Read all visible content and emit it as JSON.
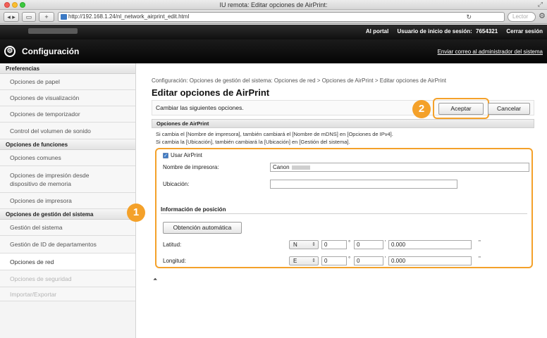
{
  "window": {
    "title": "IU remota: Editar opciones de AirPrint:",
    "url": "http://192.168.1.24/nl_network_airprint_edit.html",
    "search_placeholder": "Lector",
    "reload_icon": "reload-icon"
  },
  "topbar": {
    "portal": "Al portal",
    "user_label": "Usuario de inicio de sesión:",
    "user_id": "7654321",
    "logout": "Cerrar sesión"
  },
  "header": {
    "title": "Configuración",
    "mail_link": "Enviar correo al administrador del sistema"
  },
  "sidebar": {
    "sections": [
      {
        "heading": "Preferencias",
        "items": [
          "Opciones de papel",
          "Opciones de visualización",
          "Opciones de temporizador",
          "Control del volumen de sonido"
        ]
      },
      {
        "heading": "Opciones de funciones",
        "items": [
          "Opciones comunes",
          "Opciones de impresión desde dispositivo de memoria",
          "Opciones de impresora"
        ]
      },
      {
        "heading": "Opciones de gestión del sistema",
        "items": [
          "Gestión del sistema",
          "Gestión de ID de departamentos",
          "Opciones de red",
          "Opciones de seguridad",
          "Importar/Exportar"
        ]
      }
    ],
    "active_item": "Opciones de red"
  },
  "main": {
    "breadcrumb": "Configuración: Opciones de gestión del sistema: Opciones de red > Opciones de AirPrint > Editar opciones de AirPrint",
    "title": "Editar opciones de AirPrint",
    "instruction": "Cambiar las siguientes opciones.",
    "ok_label": "Aceptar",
    "cancel_label": "Cancelar",
    "section_heading": "Opciones de AirPrint",
    "note1": "Si cambia el [Nombre de impresora], también cambiará el [Nombre de mDNS] en [Opciones de IPv4].",
    "note2": "Si cambia la [Ubicación], también cambiará la [Ubicación] en [Gestión del sistema].",
    "use_airprint_label": "Usar AirPrint",
    "use_airprint_checked": true,
    "printer_name_label": "Nombre de impresora:",
    "printer_name_value": "Canon",
    "location_label": "Ubicación:",
    "location_value": "",
    "position_heading": "Información de posición",
    "auto_button": "Obtención automática",
    "latitude_label": "Latitud:",
    "latitude_dir": "N",
    "latitude_deg": "0",
    "latitude_min": "0",
    "latitude_sec": "0.000",
    "longitude_label": "Longitud:",
    "longitude_dir": "E",
    "longitude_deg": "0",
    "longitude_min": "0",
    "longitude_sec": "0.000",
    "deg_symbol": "°",
    "min_symbol": "'",
    "sec_symbol": "\"",
    "callout_1": "1",
    "callout_2": "2",
    "accent_color": "#f4a12a"
  }
}
